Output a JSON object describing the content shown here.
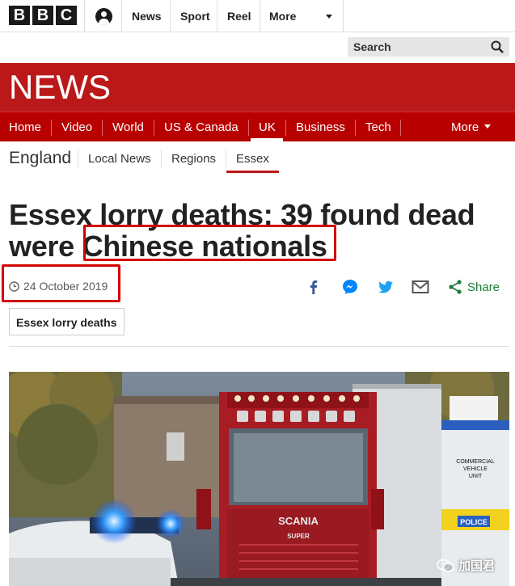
{
  "masthead": {
    "logo_letters": [
      "B",
      "B",
      "C"
    ],
    "links": [
      "News",
      "Sport",
      "Reel",
      "More"
    ],
    "search_label": "Search"
  },
  "banner": {
    "title": "NEWS"
  },
  "nav": {
    "items": [
      "Home",
      "Video",
      "World",
      "US & Canada",
      "UK",
      "Business",
      "Tech"
    ],
    "more_label": "More",
    "active": "UK"
  },
  "subnav": {
    "section": "England",
    "items": [
      "Local News",
      "Regions",
      "Essex"
    ],
    "active": "Essex"
  },
  "article": {
    "headline_line1": "Essex lorry deaths: 39 found dead",
    "headline_line2_prefix": "were ",
    "headline_line2_highlight": "Chinese nationals",
    "date": "24 October 2019",
    "share_label": "Share",
    "tag": "Essex lorry deaths"
  },
  "share_icons": [
    "facebook-icon",
    "messenger-icon",
    "twitter-icon",
    "email-icon",
    "share-icon"
  ],
  "photo": {
    "truck_brand": "SCANIA",
    "truck_grill": "SUPER",
    "van_text_1": "COMMERCIAL",
    "van_text_2": "VEHICLE",
    "van_text_3": "UNIT",
    "van_text_4": "POLICE"
  },
  "watermark": {
    "text": "加国君"
  },
  "colors": {
    "bbc_red": "#bb1919",
    "nav_red": "#b80000",
    "highlight_box": "#d40000",
    "share_green": "#1d7d3a",
    "facebook": "#3b5998",
    "messenger": "#0084ff",
    "twitter": "#1da1f2"
  }
}
